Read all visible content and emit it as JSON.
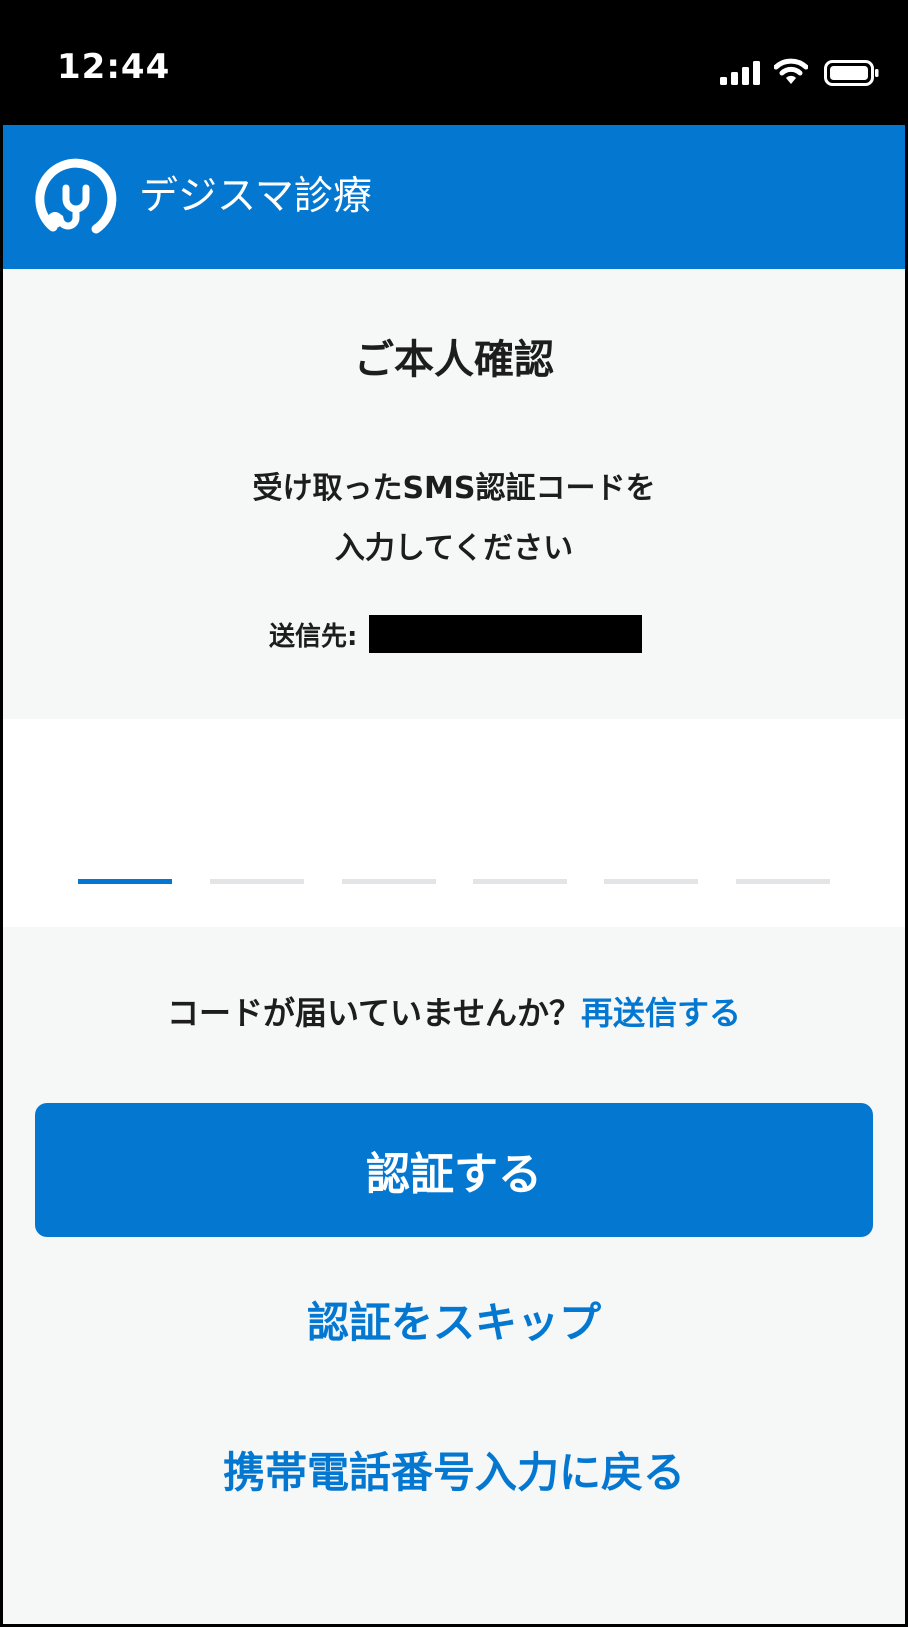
{
  "status_bar": {
    "time": "12:44",
    "icons": [
      "signal-icon",
      "wifi-icon",
      "battery-icon"
    ]
  },
  "header": {
    "logo_icon": "stethoscope-logo-icon",
    "app_title": "デジスマ診療",
    "background_color": "#0477d1"
  },
  "main": {
    "title": "ご本人確認",
    "instruction_line1": "受け取ったSMS認証コードを",
    "instruction_line2": "入力してください",
    "send_to_label": "送信先:",
    "send_to_value": "",
    "code_slots": 6,
    "active_slot": 1,
    "resend_question": "コードが届いていませんか？",
    "resend_link": "再送信する",
    "verify_button": "認証する",
    "skip_link": "認証をスキップ",
    "back_link": "携帯電話番号入力に戻る"
  },
  "colors": {
    "accent": "#0477d1",
    "text": "#1d1d1d",
    "background": "#f6f7f7",
    "inactive_slot": "#e3e4e5"
  }
}
